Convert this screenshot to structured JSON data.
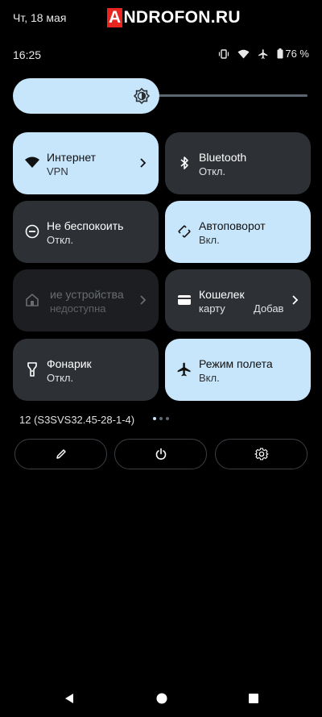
{
  "header": {
    "date": "Чт, 18 мая",
    "watermark_letter": "A",
    "watermark_rest": "NDROFON.RU"
  },
  "status": {
    "time": "16:25",
    "battery": "76 %"
  },
  "brightness": {
    "level": 0.46
  },
  "tiles": [
    {
      "label": "Интернет",
      "sub": "VPN",
      "state": "on"
    },
    {
      "label": "Bluetooth",
      "sub": "Откл.",
      "state": "off"
    },
    {
      "label": "Не беспокоить",
      "sub": "Откл.",
      "state": "off"
    },
    {
      "label": "Автоповорот",
      "sub": "Вкл.",
      "state": "on"
    },
    {
      "label": "ие устройства",
      "sub": "недоступна",
      "state": "disabled"
    },
    {
      "label": "Кошелек",
      "sub": "карту",
      "sub2": "Добав",
      "state": "off"
    },
    {
      "label": "Фонарик",
      "sub": "Откл.",
      "state": "off"
    },
    {
      "label": "Режим полета",
      "sub": "Вкл.",
      "state": "on"
    }
  ],
  "footer": {
    "build": "12 (S3SVS32.45-28-1-4)"
  },
  "icons": [
    "wifi-icon",
    "bluetooth-icon",
    "dnd-icon",
    "rotate-icon",
    "home-icon",
    "wallet-icon",
    "flashlight-icon",
    "airplane-icon",
    "edit-icon",
    "power-icon",
    "settings-icon",
    "back-icon",
    "home-nav-icon",
    "recents-icon"
  ],
  "colors": {
    "tile_on": "#c8e6fb",
    "tile_off": "#2d3136",
    "background": "#000000"
  }
}
